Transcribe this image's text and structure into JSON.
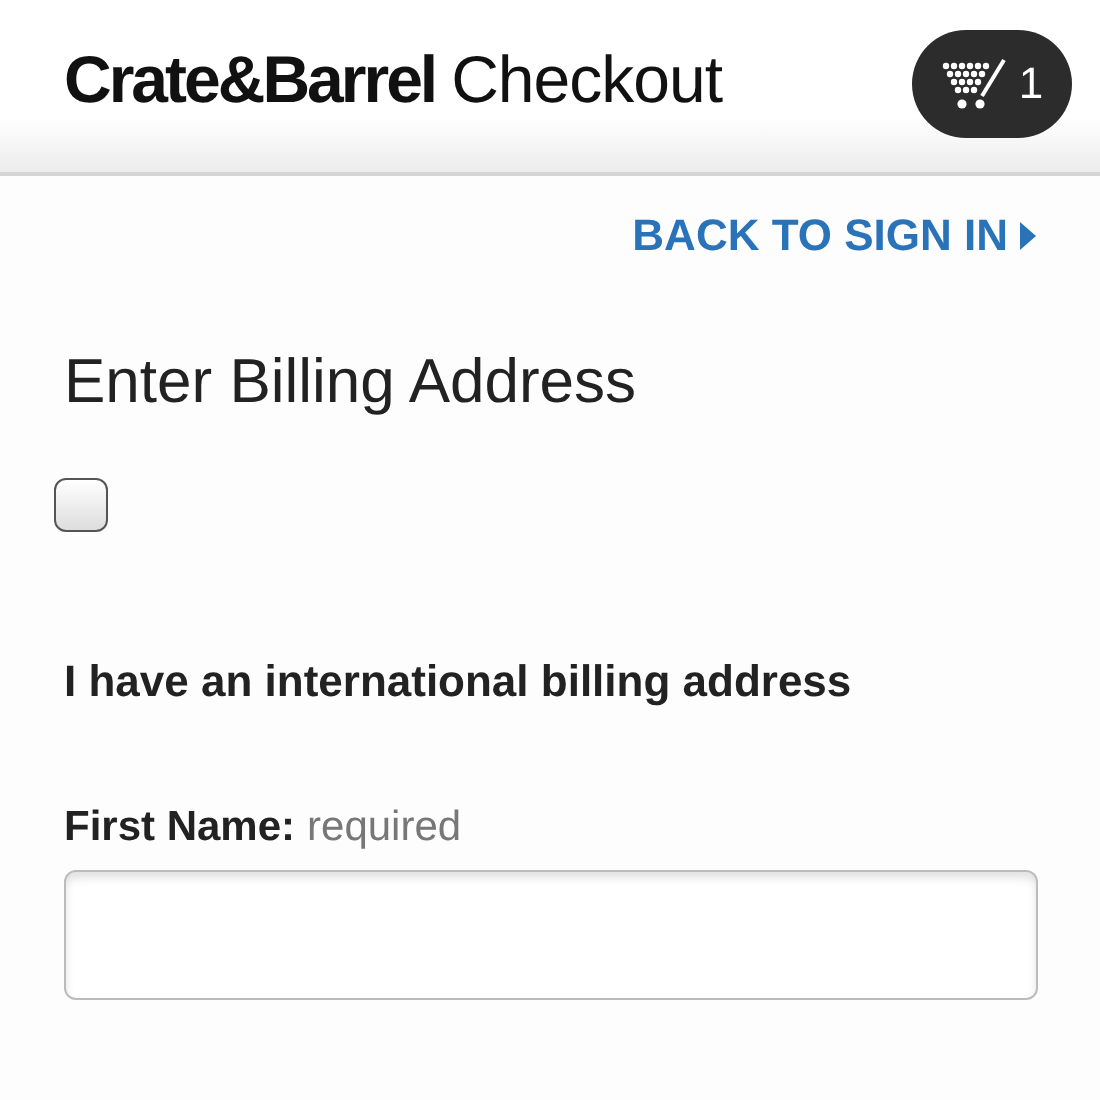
{
  "header": {
    "brand": "Crate&Barrel",
    "title": "Checkout",
    "cart_count": "1"
  },
  "back_link": {
    "label": "BACK TO SIGN IN"
  },
  "heading": "Enter Billing Address",
  "international": {
    "checked": false,
    "label": "I have an international billing address"
  },
  "fields": [
    {
      "label": "First Name:",
      "hint": "required"
    }
  ]
}
